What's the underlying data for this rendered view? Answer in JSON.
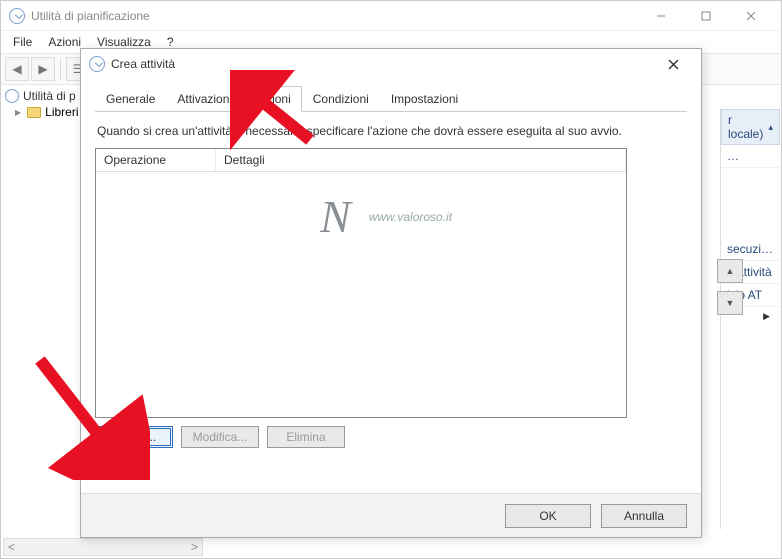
{
  "main_window": {
    "title": "Utilità di pianificazione",
    "menu": {
      "file": "File",
      "action": "Azioni",
      "view": "Visualizza",
      "help": "?"
    }
  },
  "tree": {
    "root": "Utilità di p",
    "child": "Libreri"
  },
  "right_pane": {
    "header": "r locale)",
    "items": [
      "…",
      "secuzio…",
      "e attività",
      "izio AT"
    ]
  },
  "dialog": {
    "title": "Crea attività",
    "tabs": {
      "general": "Generale",
      "triggers": "Attivazione",
      "actions": "Azioni",
      "conditions": "Condizioni",
      "settings": "Impostazioni"
    },
    "active_tab": "actions",
    "description": "Quando si crea un'attività è necessario specificare l'azione che dovrà essere eseguita al suo avvio.",
    "columns": {
      "operation": "Operazione",
      "details": "Dettagli"
    },
    "buttons": {
      "new": "Nuova...",
      "edit": "Modifica...",
      "delete": "Elimina"
    },
    "footer": {
      "ok": "OK",
      "cancel": "Annulla"
    }
  },
  "watermark": {
    "logo": "N",
    "url": "www.valoroso.it"
  },
  "arrow_glyphs": {
    "up": "▲",
    "down": "▼",
    "right": "▶",
    "left": "◀",
    "collapse_up": "▴"
  }
}
